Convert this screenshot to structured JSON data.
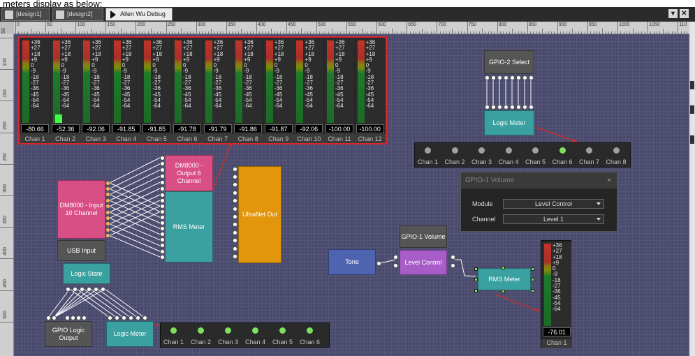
{
  "top_text": "meters display as below:",
  "tabs": [
    {
      "label": "[design1]"
    },
    {
      "label": "[design2]"
    },
    {
      "label": "Allen Wu Debug"
    }
  ],
  "window_buttons": {
    "minimize": "▾",
    "close": "✕"
  },
  "ruler_x": [
    "0",
    "50",
    "100",
    "150",
    "200",
    "250",
    "300",
    "350",
    "400",
    "450",
    "500",
    "550",
    "600",
    "650",
    "700",
    "750",
    "800",
    "850",
    "900",
    "950",
    "1000",
    "1050",
    "110"
  ],
  "ruler_y": [
    "50",
    "100",
    "150",
    "200",
    "250",
    "300",
    "350",
    "400",
    "450",
    "500"
  ],
  "meter_scale": [
    "+36",
    "+27",
    "+18",
    "+9",
    "0",
    "-9",
    "-18",
    "-27",
    "-36",
    "-45",
    "-54",
    "-64"
  ],
  "meters": [
    {
      "label": "Chan 1",
      "readout": "-80.66",
      "level": 0
    },
    {
      "label": "Chan 2",
      "readout": "-52.36",
      "level": 0.1
    },
    {
      "label": "Chan 3",
      "readout": "-92.06",
      "level": 0
    },
    {
      "label": "Chan 4",
      "readout": "-91.85",
      "level": 0
    },
    {
      "label": "Chan 5",
      "readout": "-91.85",
      "level": 0
    },
    {
      "label": "Chan 6",
      "readout": "-91.78",
      "level": 0
    },
    {
      "label": "Chan 7",
      "readout": "-91.79",
      "level": 0
    },
    {
      "label": "Chan 8",
      "readout": "-91.86",
      "level": 0
    },
    {
      "label": "Chan 9",
      "readout": "-91.87",
      "level": 0
    },
    {
      "label": "Chan 10",
      "readout": "-92.06",
      "level": 0
    },
    {
      "label": "Chan 11",
      "readout": "-100.00",
      "level": 0
    },
    {
      "label": "Chan 12",
      "readout": "-100.00",
      "level": 0
    }
  ],
  "blocks": {
    "dm_input": "DM8000 - Input 10 Channel",
    "usb_input": "USB Input",
    "dm_output": "DM8000 - Output 6 Channel",
    "rms_meter_main": "RMS Meter",
    "ultranet": "UltraNet Out",
    "logic_state": "Logic State",
    "gpio_logic_output": "GPIO Logic Output",
    "logic_meter_bottom": "Logic Meter",
    "gpio2_select": "GPIO-2 Select",
    "logic_meter_top": "Logic Meter",
    "gpio1_volume": "GPIO-1 Volume",
    "tone": "Tone",
    "level_control": "Level Control",
    "rms_meter_small": "RMS Meter"
  },
  "led_row_top": {
    "labels": [
      "Chan 1",
      "Chan 2",
      "Chan 3",
      "Chan 4",
      "Chan 5",
      "Chan 6",
      "Chan 7",
      "Chan 8"
    ],
    "active": [
      false,
      false,
      false,
      false,
      false,
      true,
      false,
      false
    ]
  },
  "led_row_bottom": {
    "labels": [
      "Chan 1",
      "Chan 2",
      "Chan 3",
      "Chan 4",
      "Chan 5",
      "Chan 6"
    ],
    "active": [
      true,
      true,
      true,
      true,
      true,
      true
    ]
  },
  "gpio1_dialog": {
    "title": "GPIO-1 Volume",
    "close": "×",
    "module_label": "Module",
    "module_value": "Level Control",
    "channel_label": "Channel",
    "channel_value": "Level 1"
  },
  "single_meter": {
    "label": "Chan 1",
    "readout": "-76.01",
    "level": 0
  },
  "colors": {
    "canvas": "#4a4a6c",
    "highlight": "#d9262e",
    "led_on": "#7ee05b",
    "led_off": "#a0a0a0"
  }
}
